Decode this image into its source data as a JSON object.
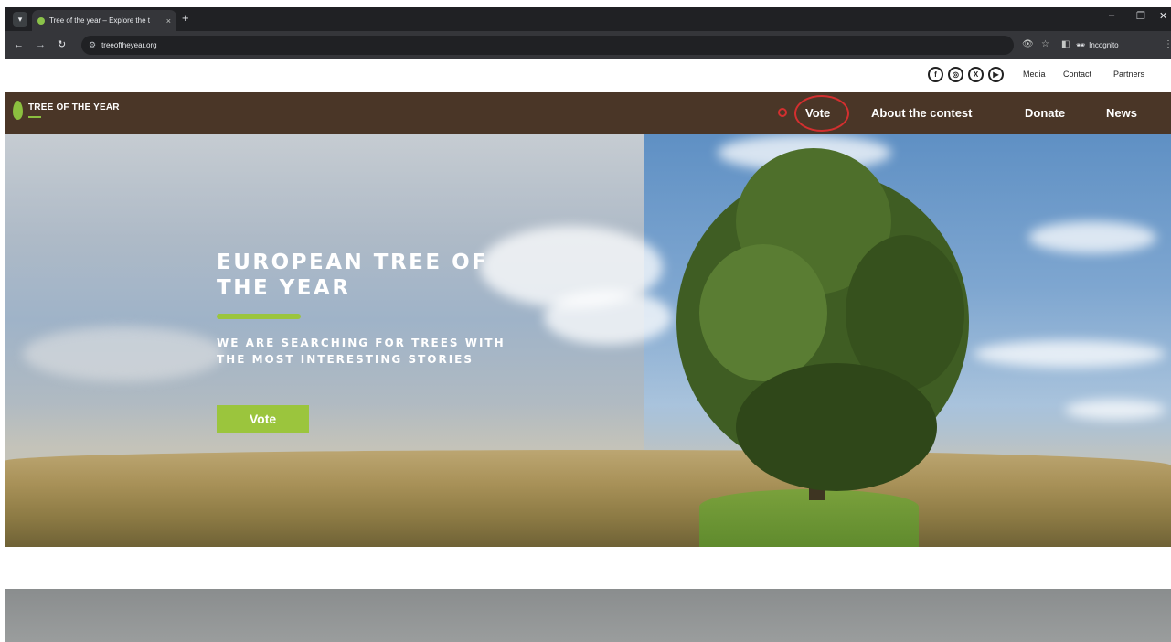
{
  "browser": {
    "tab_title": "Tree of the year – Explore the t",
    "url": "treeoftheyear.org",
    "incognito_label": "Incognito",
    "new_tab_glyph": "+",
    "tab_close_glyph": "×"
  },
  "topbar": {
    "social": [
      {
        "icon": "facebook-icon",
        "glyph": "f"
      },
      {
        "icon": "instagram-icon",
        "glyph": "◎"
      },
      {
        "icon": "x-icon",
        "glyph": "X"
      },
      {
        "icon": "youtube-icon",
        "glyph": "▶"
      }
    ],
    "links": [
      "Media",
      "Contact",
      "Partners"
    ]
  },
  "nav": {
    "logo_text": "TREE OF THE YEAR",
    "items": [
      "Vote",
      "About the contest",
      "Donate",
      "News"
    ],
    "highlight_color": "#d32f2f"
  },
  "hero": {
    "title": "EUROPEAN TREE OF THE YEAR",
    "subtitle": "WE ARE SEARCHING FOR TREES WITH THE MOST INTERESTING STORIES",
    "cta_label": "Vote"
  },
  "colors": {
    "nav_bg": "#4a3627",
    "accent_green": "#9bc53d"
  }
}
